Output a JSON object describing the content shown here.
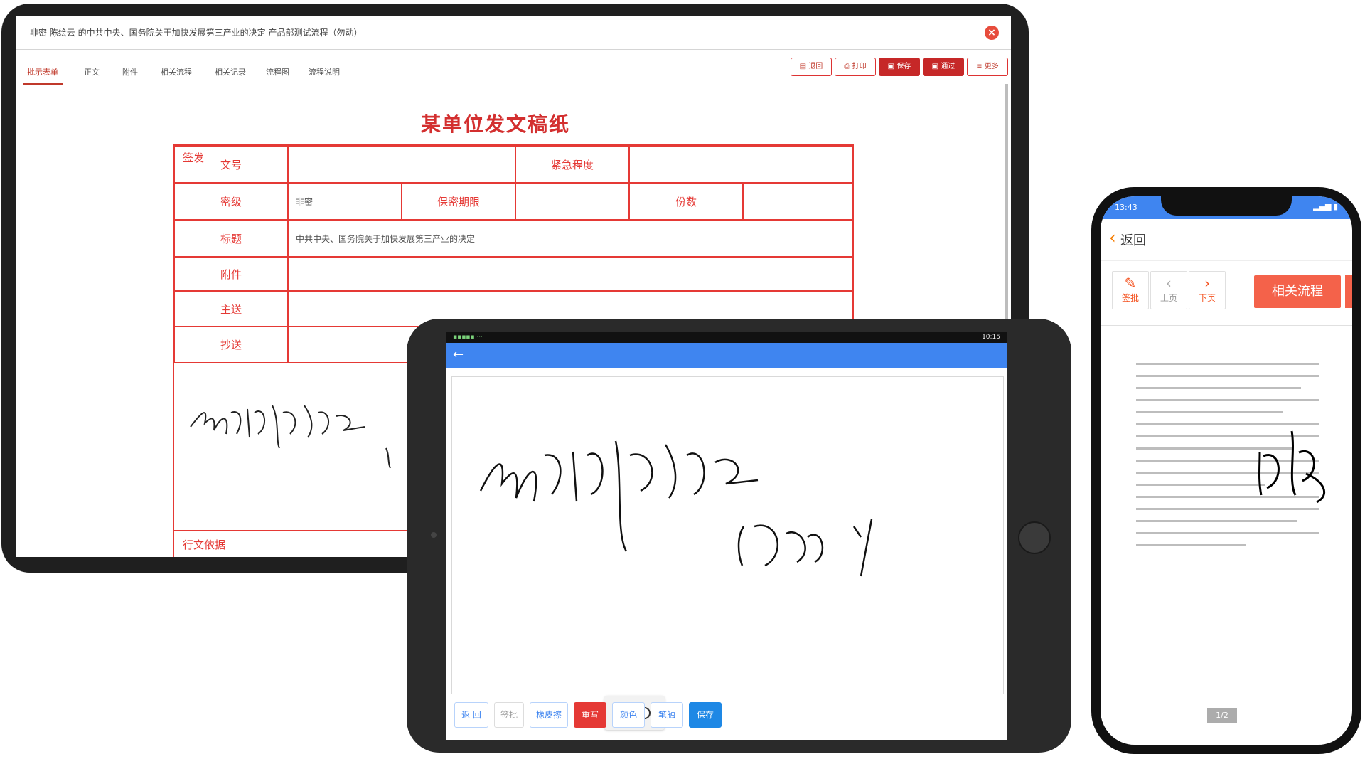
{
  "laptop": {
    "window_title": "非密 陈绘云 的中共中央、国务院关于加快发展第三产业的决定 产品部测试流程（勿动）",
    "tabs": [
      "批示表单",
      "正文",
      "附件",
      "相关流程",
      "相关记录",
      "流程图",
      "流程说明"
    ],
    "buttons": {
      "back": "退回",
      "print": "打印",
      "save": "保存",
      "pass": "通过",
      "more": "更多"
    },
    "doc_title": "某单位发文稿纸",
    "form": {
      "doc_no": "文号",
      "urgency": "紧急程度",
      "secret_level": "密级",
      "secret_value": "非密",
      "secret_period": "保密期限",
      "copies": "份数",
      "subject": "标题",
      "subject_value": "中共中央、国务院关于加快发展第三产业的决定",
      "attachment": "附件",
      "main_send": "主送",
      "cc": "抄送",
      "sign": "签发",
      "basis": "行文依据"
    }
  },
  "tablet": {
    "status_time": "10:15",
    "buttons": {
      "back": "返 回",
      "approve": "签批",
      "eraser": "橡皮擦",
      "rewrite": "重写",
      "color": "颜色",
      "brush": "笔触",
      "save": "保存"
    },
    "colors": {
      "accent": "#3f85f0",
      "red": "#e53935"
    }
  },
  "phone": {
    "status_time": "13:43",
    "back_label": "返回",
    "tools": {
      "sign": "签批",
      "prev": "上页",
      "next": "下页"
    },
    "related_button": "相关流程",
    "page_badge": "1/2"
  }
}
